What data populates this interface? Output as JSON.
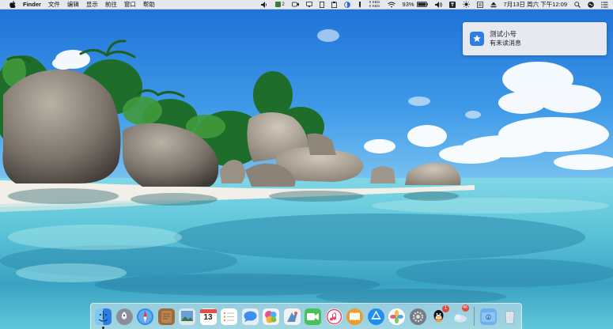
{
  "menubar": {
    "app_name": "Finder",
    "menus": [
      "文件",
      "编辑",
      "显示",
      "前往",
      "窗口",
      "帮助"
    ],
    "status": {
      "badge_count": "2",
      "net_up": "0 KB/s",
      "net_down": "0 KB/s",
      "battery_percent": "93%",
      "datetime": "7月13日 周六 下午12:09"
    }
  },
  "notification": {
    "title": "测试小号",
    "message": "有未读消息"
  },
  "dock": {
    "calendar_day": "13",
    "qq_badge": "1",
    "weather_badge": "46"
  },
  "colors": {
    "sky": "#2f8fe0",
    "sea": "#5fd0e0",
    "sand": "#f2efe8",
    "accent": "#2f7de1",
    "badge": "#e8453c"
  }
}
